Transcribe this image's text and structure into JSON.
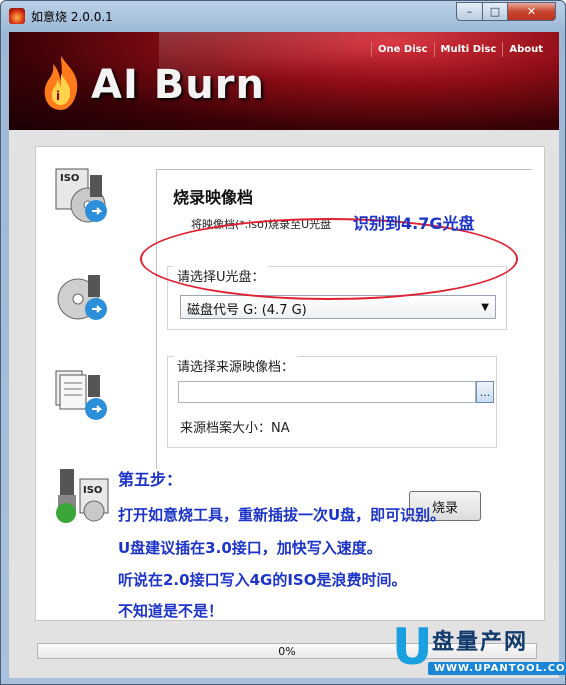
{
  "window": {
    "title": "如意烧 2.0.0.1",
    "min_label": "–",
    "max_label": "□",
    "close_label": "✕"
  },
  "header": {
    "brand": "AI Burn",
    "nav": [
      "One Disc",
      "Multi Disc",
      "About"
    ]
  },
  "panel": {
    "title": "烧录映像档",
    "description": "将映像档(*.iso)烧录至U光盘",
    "usb_group_label": "请选择U光盘：",
    "usb_selected": "磁盘代号 G: (4.7 G)",
    "source_group_label": "请选择来源映像档：",
    "source_path": "",
    "browse_label": "...",
    "size_label": "来源档案大小：NA",
    "burn_button": "烧录"
  },
  "annotations": {
    "detected": "识别到4.7G光盘",
    "step": "第五步：",
    "line1": "打开如意烧工具，重新插拔一次U盘，即可识别。",
    "line2": "U盘建议插在3.0接口，加快写入速度。",
    "line3": "听说在2.0接口写入4G的ISO是浪费时间。",
    "line4": "不知道是不是！"
  },
  "progress": {
    "value": 0,
    "label": "0%"
  },
  "watermark": {
    "big": "U",
    "cn": "盘量产网",
    "url": "WWW.UPANTOOL.COM"
  },
  "icons": [
    "iso-disc-usb-icon",
    "disc-usb-icon",
    "docs-disc-usb-icon",
    "usb-iso-icon"
  ],
  "colors": {
    "annotation_blue": "#1d34c9",
    "oval_red": "#e02030",
    "banner_red": "#8c0c16"
  }
}
